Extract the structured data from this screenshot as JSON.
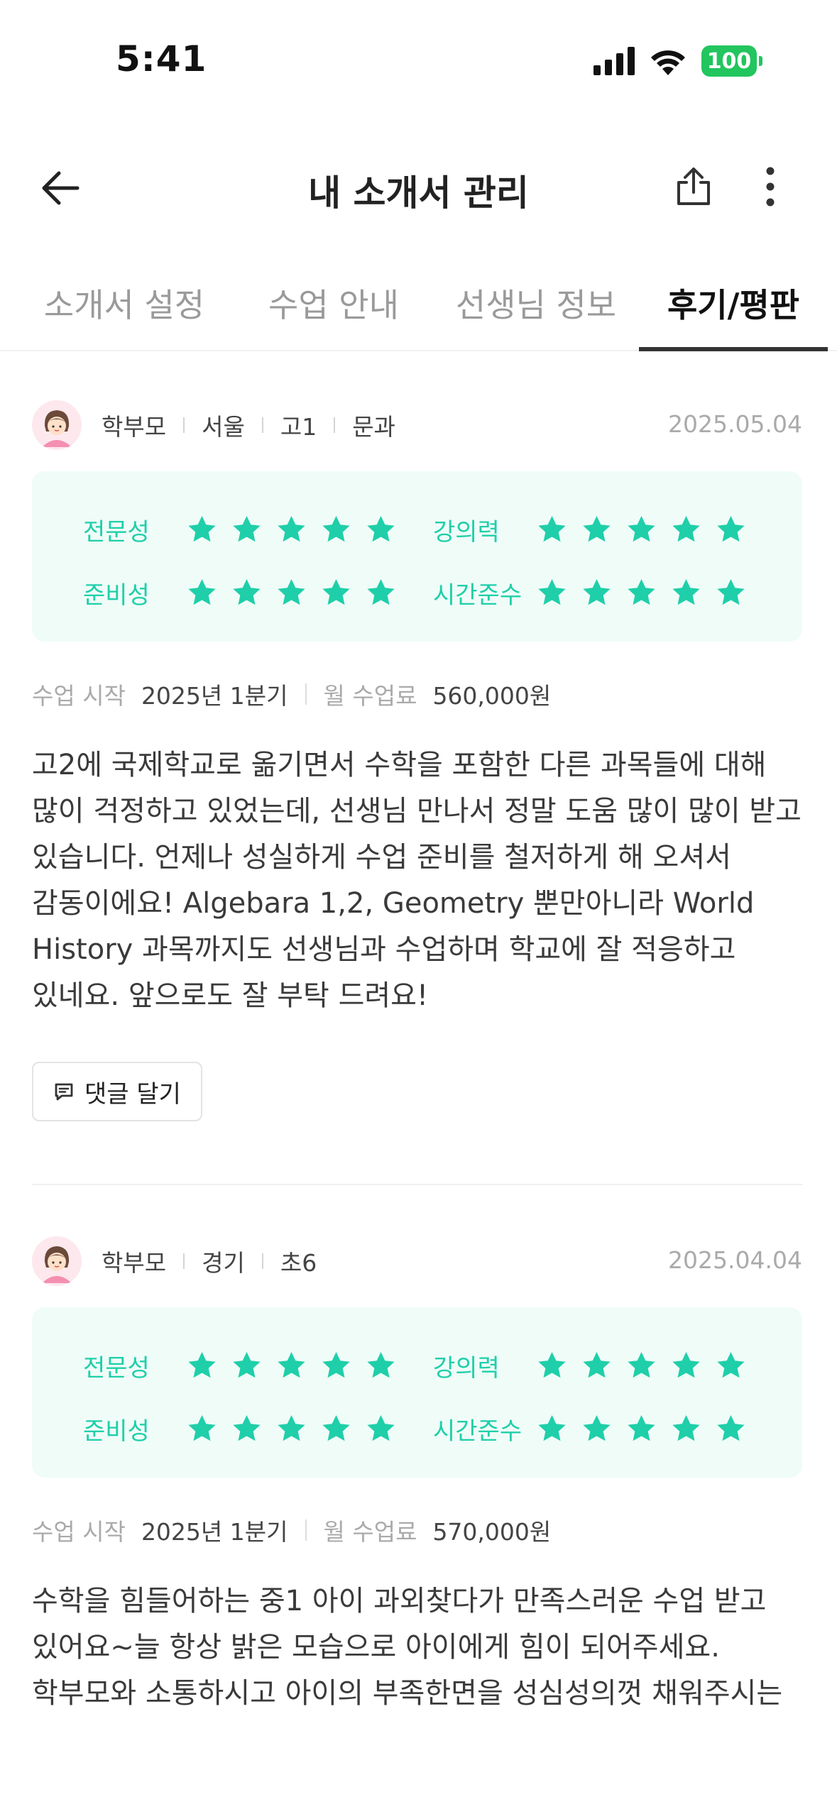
{
  "status_bar": {
    "time": "5:41",
    "battery": "100",
    "battery_color": "#22c55e"
  },
  "header": {
    "title": "내 소개서 관리",
    "back_icon": "arrow-left-icon",
    "share_icon": "share-icon",
    "more_icon": "more-vertical-icon"
  },
  "tabs": [
    {
      "label": "소개서 설정",
      "active": false
    },
    {
      "label": "수업 안내",
      "active": false
    },
    {
      "label": "선생님 정보",
      "active": false
    },
    {
      "label": "후기/평판",
      "active": true
    }
  ],
  "theme": {
    "accent": "#1fcfa9",
    "rating_bg": "#effcf8"
  },
  "reviews": [
    {
      "meta": [
        "학부모",
        "서울",
        "고1",
        "문과"
      ],
      "date": "2025.05.04",
      "ratings": [
        {
          "label": "전문성",
          "stars": 5
        },
        {
          "label": "강의력",
          "stars": 5
        },
        {
          "label": "준비성",
          "stars": 5
        },
        {
          "label": "시간준수",
          "stars": 5
        }
      ],
      "start_label": "수업 시작",
      "start_value": "2025년 1분기",
      "fee_label": "월 수업료",
      "fee_value": "560,000원",
      "body": "고2에 국제학교로 옮기면서 수학을 포함한 다른 과목들에 대해 많이 걱정하고 있었는데, 선생님 만나서 정말 도움 많이 많이 받고 있습니다. 언제나 성실하게 수업 준비를 철저하게 해 오셔서 감동이에요! Algebara 1,2, Geometry 뿐만아니라 World History 과목까지도 선생님과 수업하며 학교에 잘 적응하고 있네요. 앞으로도 잘 부탁 드려요!",
      "comment_label": "댓글 달기"
    },
    {
      "meta": [
        "학부모",
        "경기",
        "초6"
      ],
      "date": "2025.04.04",
      "ratings": [
        {
          "label": "전문성",
          "stars": 5
        },
        {
          "label": "강의력",
          "stars": 5
        },
        {
          "label": "준비성",
          "stars": 5
        },
        {
          "label": "시간준수",
          "stars": 5
        }
      ],
      "start_label": "수업 시작",
      "start_value": "2025년 1분기",
      "fee_label": "월 수업료",
      "fee_value": "570,000원",
      "body": "수학을 힘들어하는 중1 아이 과외찾다가 만족스러운 수업 받고 있어요~늘 항상 밝은 모습으로 아이에게 힘이 되어주세요. 학부모와 소통하시고 아이의 부족한면을 성심성의껏 채워주시는"
    }
  ]
}
